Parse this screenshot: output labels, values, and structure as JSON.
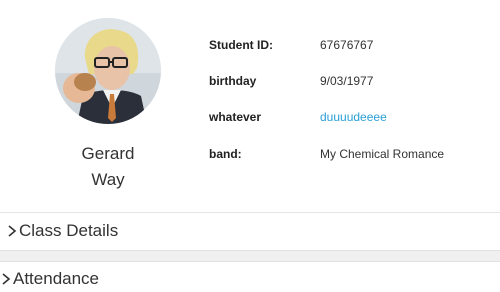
{
  "profile": {
    "name_line1": "Gerard",
    "name_line2": "Way",
    "avatar_icon": "student-photo",
    "fields": [
      {
        "label": "Student ID:",
        "value": "67676767",
        "link": false
      },
      {
        "label": "birthday",
        "value": "9/03/1977",
        "link": false
      },
      {
        "label": "whatever",
        "value": "duuuudeeee",
        "link": true
      },
      {
        "label": "band:",
        "value": "My Chemical Romance",
        "link": false
      }
    ]
  },
  "sections": [
    {
      "title": "Class Details",
      "icon": "chevron-right-icon"
    },
    {
      "title": "Attendance",
      "icon": "chevron-right-icon"
    }
  ],
  "colors": {
    "link": "#2a9fd6",
    "text": "#333333",
    "divider": "#e6e6e6"
  }
}
